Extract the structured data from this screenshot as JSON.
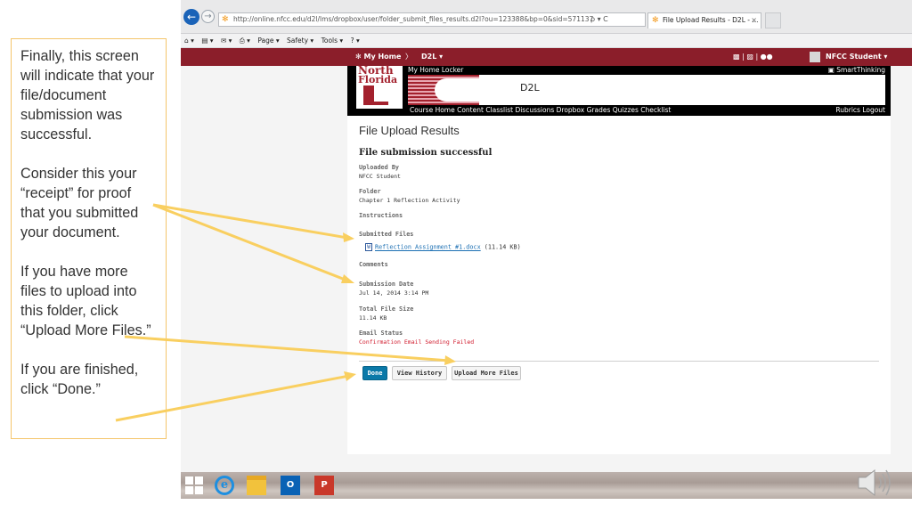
{
  "callout": {
    "p1": "Finally, this screen will indicate that your file/document submission was successful.",
    "p2": "Consider this your “receipt” for proof that you submitted your document.",
    "p3": "If you have more files to upload into this folder, click “Upload More Files.”",
    "p4": "If you are finished, click “Done.”"
  },
  "browser": {
    "url": "http://online.nfcc.edu/d2l/lms/dropbox/user/folder_submit_files_results.d2l?ou=123388&bp=0&sid=571137",
    "url_tools": "ρ ▾ C",
    "tab_title": "File Upload Results - D2L - ...",
    "tab_close": "×",
    "back_glyph": "←",
    "fwd_glyph": "→",
    "commands": [
      "Page ▾",
      "Safety ▾",
      "Tools ▾"
    ]
  },
  "d2l_nav": {
    "my_home": "My Home",
    "separator": "〉",
    "d2l": "D2L  ▾",
    "icons": "▩  |  ▨  |  ●●",
    "user": "NFCC Student ▾"
  },
  "banner": {
    "logo_line1": "North",
    "logo_line2": "Florida",
    "top_links": "My Home  Locker",
    "smart_thinking": "SmartThinking",
    "title": "D2L",
    "menu": "Course Home  Content  Classlist  Discussions  Dropbox  Grades  Quizzes  Checklist",
    "right_links": "Rubrics  Logout"
  },
  "results": {
    "page_title": "File Upload Results",
    "success": "File submission successful",
    "uploaded_by_label": "Uploaded By",
    "uploaded_by": "NFCC Student",
    "folder_label": "Folder",
    "folder": "Chapter 1 Reflection Activity",
    "instructions_label": "Instructions",
    "submitted_files_label": "Submitted Files",
    "file_name": "Reflection Assignment #1.docx",
    "file_size": " (11.14 KB)",
    "comments_label": "Comments",
    "submission_date_label": "Submission Date",
    "submission_date": "Jul 14, 2014 3:14 PM",
    "total_size_label": "Total File Size",
    "total_size": "11.14 KB",
    "email_status_label": "Email Status",
    "email_status": "Confirmation Email Sending Failed"
  },
  "buttons": {
    "done": "Done",
    "view_history": "View History",
    "upload_more": "Upload More Files"
  },
  "colors": {
    "callout_border": "#f4c56b",
    "arrow": "#f9cf60",
    "d2l_nav": "#8b1e2a",
    "primary_button": "#0a79a8",
    "error_text": "#d0192b"
  }
}
